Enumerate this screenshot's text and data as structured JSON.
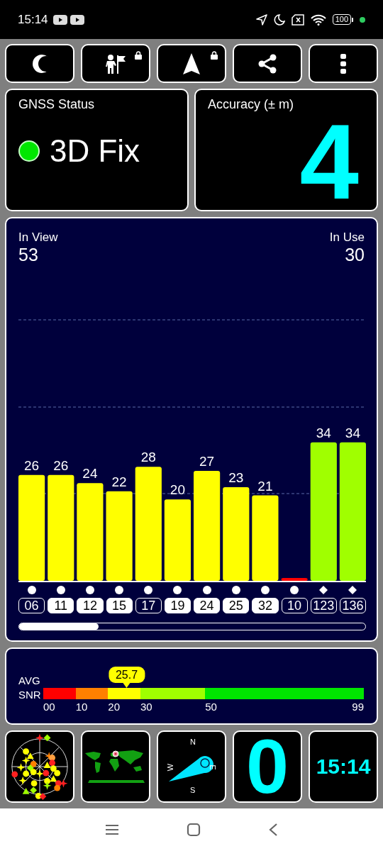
{
  "status_bar": {
    "time": "15:14",
    "battery": "100"
  },
  "toolbar": {
    "buttons": [
      {
        "kind": "night",
        "locked": false
      },
      {
        "kind": "person-flag",
        "locked": true
      },
      {
        "kind": "navigation",
        "locked": true
      },
      {
        "kind": "share",
        "locked": false
      },
      {
        "kind": "more",
        "locked": false
      }
    ]
  },
  "gnss_status": {
    "title": "GNSS Status",
    "value": "3D Fix",
    "color": "#00e600"
  },
  "accuracy": {
    "title": "Accuracy (± m)",
    "value": "4"
  },
  "satellites_panel": {
    "in_view_label": "In View",
    "in_view": "53",
    "in_use_label": "In Use",
    "in_use": "30",
    "chart_data": {
      "type": "bar",
      "categories": [
        "06",
        "11",
        "12",
        "15",
        "17",
        "19",
        "24",
        "25",
        "32",
        "10",
        "123",
        "136"
      ],
      "values": [
        26,
        26,
        24,
        22,
        28,
        20,
        27,
        23,
        21,
        0,
        34,
        34
      ],
      "value_labels": [
        "26",
        "26",
        "24",
        "22",
        "28",
        "20",
        "27",
        "23",
        "21",
        null,
        "34",
        "34"
      ]
    },
    "satellites": [
      {
        "used": false,
        "kind": "circle"
      },
      {
        "used": true,
        "kind": "circle"
      },
      {
        "used": true,
        "kind": "circle"
      },
      {
        "used": true,
        "kind": "circle"
      },
      {
        "used": false,
        "kind": "circle"
      },
      {
        "used": true,
        "kind": "circle"
      },
      {
        "used": true,
        "kind": "circle"
      },
      {
        "used": true,
        "kind": "circle"
      },
      {
        "used": true,
        "kind": "circle"
      },
      {
        "used": false,
        "kind": "circle"
      },
      {
        "used": false,
        "kind": "diamond"
      },
      {
        "used": false,
        "kind": "diamond"
      }
    ]
  },
  "avg_snr": {
    "label_1": "AVG",
    "label_2": "SNR",
    "value": "25.7",
    "level": 0.26,
    "ticks": [
      "00",
      "10",
      "20",
      "30",
      "50",
      "99"
    ],
    "segments": [
      {
        "color": "#ff0000"
      },
      {
        "color": "#ff8000"
      },
      {
        "color": "#ffff00"
      },
      {
        "color": "#a0ff00"
      },
      {
        "color": "#00e600"
      }
    ]
  },
  "tiles": {
    "compass": {
      "north": "N",
      "east": "E",
      "south": "S",
      "west": "W"
    },
    "speed": "0",
    "clock": "15:14"
  }
}
